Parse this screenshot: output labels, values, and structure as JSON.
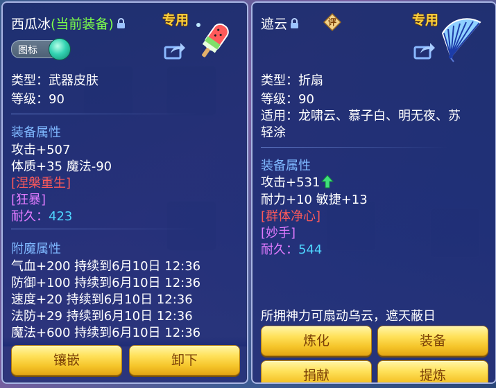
{
  "left": {
    "name": "西瓜冰",
    "status": "(当前装备)",
    "exclusive": "专用",
    "toggle_label": "图标",
    "type_line": "类型：武器皮肤",
    "level_line": "等级：90",
    "equip_header": "装备属性",
    "attrs": [
      "攻击+507",
      "体质+35 魔法-90"
    ],
    "special1": "[涅槃重生]",
    "special2": "[狂暴]",
    "durability_label": "耐久：",
    "durability_value": "423",
    "enchant_header": "附魔属性",
    "enchants": [
      "气血+200 持续到6月10日 12:36",
      "防御+100 持续到6月10日 12:36",
      "速度+20 持续到6月10日 12:36",
      "法防+29 持续到6月10日 12:36",
      "魔法+600 持续到6月10日 12:36"
    ],
    "buttons": {
      "inlay": "镶嵌",
      "unequip": "卸下"
    }
  },
  "right": {
    "name": "遮云",
    "rate_badge": "评",
    "exclusive": "专用",
    "type_line": "类型：折扇",
    "level_line": "等级：90",
    "suit_line1": "适用：龙啸云、慕子白、明无夜、苏",
    "suit_line2": "轻涂",
    "equip_header": "装备属性",
    "attack": "攻击+531",
    "attr2": "耐力+10 敏捷+13",
    "special1": "[群体净心]",
    "special2": "[妙手]",
    "durability_label": "耐久：",
    "durability_value": "544",
    "description": "所拥神力可扇动乌云，遮天蔽日",
    "buttons": {
      "refine": "炼化",
      "equip": "装备",
      "donate": "捐献",
      "purify": "提炼"
    }
  },
  "icons": {
    "lock": "lock-icon",
    "share": "share-icon",
    "popsicle": "watermelon-popsicle-icon",
    "fan": "folding-fan-icon",
    "up": "green-up-arrow-icon"
  }
}
